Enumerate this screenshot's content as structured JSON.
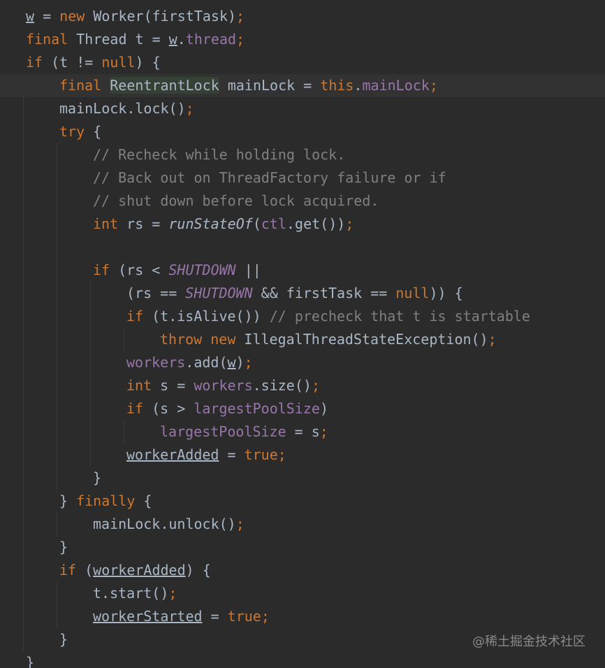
{
  "colors": {
    "background": "#2b2b2b",
    "keyword": "#cc7832",
    "identifier": "#a9b7c6",
    "field": "#9876aa",
    "comment": "#808080",
    "line_highlight": "#323232",
    "type_highlight": "#344134"
  },
  "editor": {
    "lines": [
      {
        "indent": 0,
        "tokens": [
          {
            "text": "w",
            "c": "id",
            "u": true
          },
          {
            "text": " = ",
            "c": "id"
          },
          {
            "text": "new ",
            "c": "kw"
          },
          {
            "text": "Worker(firstTask)",
            "c": "id"
          },
          {
            "text": ";",
            "c": "semi"
          }
        ]
      },
      {
        "indent": 0,
        "tokens": [
          {
            "text": "final ",
            "c": "kw"
          },
          {
            "text": "Thread t = ",
            "c": "id"
          },
          {
            "text": "w",
            "c": "id",
            "u": true
          },
          {
            "text": ".",
            "c": "id"
          },
          {
            "text": "thread",
            "c": "field"
          },
          {
            "text": ";",
            "c": "semi"
          }
        ]
      },
      {
        "indent": 0,
        "tokens": [
          {
            "text": "if ",
            "c": "kw"
          },
          {
            "text": "(t != ",
            "c": "id"
          },
          {
            "text": "null",
            "c": "kw"
          },
          {
            "text": ") {",
            "c": "id"
          }
        ]
      },
      {
        "indent": 1,
        "highlight": true,
        "tokens": [
          {
            "text": "final ",
            "c": "kw"
          },
          {
            "text": "ReentrantLock",
            "c": "typehl"
          },
          {
            "text": " mainLock = ",
            "c": "id"
          },
          {
            "text": "this",
            "c": "kw"
          },
          {
            "text": ".",
            "c": "id"
          },
          {
            "text": "mainLock",
            "c": "field"
          },
          {
            "text": ";",
            "c": "semi"
          }
        ]
      },
      {
        "indent": 1,
        "tokens": [
          {
            "text": "mainLock.lock()",
            "c": "id"
          },
          {
            "text": ";",
            "c": "semi"
          }
        ]
      },
      {
        "indent": 1,
        "tokens": [
          {
            "text": "try ",
            "c": "kw"
          },
          {
            "text": "{",
            "c": "id"
          }
        ]
      },
      {
        "indent": 2,
        "tokens": [
          {
            "text": "// Recheck while holding lock.",
            "c": "comment"
          }
        ]
      },
      {
        "indent": 2,
        "tokens": [
          {
            "text": "// Back out on ThreadFactory failure or if",
            "c": "comment"
          }
        ]
      },
      {
        "indent": 2,
        "tokens": [
          {
            "text": "// shut down before lock acquired.",
            "c": "comment"
          }
        ]
      },
      {
        "indent": 2,
        "tokens": [
          {
            "text": "int ",
            "c": "kw"
          },
          {
            "text": "rs = ",
            "c": "id"
          },
          {
            "text": "runStateOf",
            "c": "static"
          },
          {
            "text": "(",
            "c": "id"
          },
          {
            "text": "ctl",
            "c": "field"
          },
          {
            "text": ".get())",
            "c": "id"
          },
          {
            "text": ";",
            "c": "semi"
          }
        ]
      },
      {
        "indent": 2,
        "tokens": []
      },
      {
        "indent": 2,
        "tokens": [
          {
            "text": "if ",
            "c": "kw"
          },
          {
            "text": "(rs < ",
            "c": "id"
          },
          {
            "text": "SHUTDOWN",
            "c": "const"
          },
          {
            "text": " ||",
            "c": "id"
          }
        ]
      },
      {
        "indent": 3,
        "tokens": [
          {
            "text": "(rs == ",
            "c": "id"
          },
          {
            "text": "SHUTDOWN",
            "c": "const"
          },
          {
            "text": " && firstTask == ",
            "c": "id"
          },
          {
            "text": "null",
            "c": "kw"
          },
          {
            "text": ")) {",
            "c": "id"
          }
        ]
      },
      {
        "indent": 3,
        "tokens": [
          {
            "text": "if ",
            "c": "kw"
          },
          {
            "text": "(t.isAlive()) ",
            "c": "id"
          },
          {
            "text": "// precheck that t is startable",
            "c": "comment"
          }
        ]
      },
      {
        "indent": 4,
        "tokens": [
          {
            "text": "throw new ",
            "c": "kw"
          },
          {
            "text": "IllegalThreadStateException()",
            "c": "id"
          },
          {
            "text": ";",
            "c": "semi"
          }
        ]
      },
      {
        "indent": 3,
        "tokens": [
          {
            "text": "workers",
            "c": "field"
          },
          {
            "text": ".add(",
            "c": "id"
          },
          {
            "text": "w",
            "c": "id",
            "u": true
          },
          {
            "text": ")",
            "c": "id"
          },
          {
            "text": ";",
            "c": "semi"
          }
        ]
      },
      {
        "indent": 3,
        "tokens": [
          {
            "text": "int ",
            "c": "kw"
          },
          {
            "text": "s = ",
            "c": "id"
          },
          {
            "text": "workers",
            "c": "field"
          },
          {
            "text": ".size()",
            "c": "id"
          },
          {
            "text": ";",
            "c": "semi"
          }
        ]
      },
      {
        "indent": 3,
        "tokens": [
          {
            "text": "if ",
            "c": "kw"
          },
          {
            "text": "(s > ",
            "c": "id"
          },
          {
            "text": "largestPoolSize",
            "c": "field"
          },
          {
            "text": ")",
            "c": "id"
          }
        ]
      },
      {
        "indent": 4,
        "tokens": [
          {
            "text": "largestPoolSize",
            "c": "field"
          },
          {
            "text": " = s",
            "c": "id"
          },
          {
            "text": ";",
            "c": "semi"
          }
        ]
      },
      {
        "indent": 3,
        "tokens": [
          {
            "text": "workerAdded",
            "c": "id",
            "u": true
          },
          {
            "text": " = ",
            "c": "id"
          },
          {
            "text": "true",
            "c": "kw"
          },
          {
            "text": ";",
            "c": "semi"
          }
        ]
      },
      {
        "indent": 2,
        "tokens": [
          {
            "text": "}",
            "c": "id"
          }
        ]
      },
      {
        "indent": 1,
        "tokens": [
          {
            "text": "} ",
            "c": "id"
          },
          {
            "text": "finally ",
            "c": "kw"
          },
          {
            "text": "{",
            "c": "id"
          }
        ]
      },
      {
        "indent": 2,
        "tokens": [
          {
            "text": "mainLock.unlock()",
            "c": "id"
          },
          {
            "text": ";",
            "c": "semi"
          }
        ]
      },
      {
        "indent": 1,
        "tokens": [
          {
            "text": "}",
            "c": "id"
          }
        ]
      },
      {
        "indent": 1,
        "tokens": [
          {
            "text": "if ",
            "c": "kw"
          },
          {
            "text": "(",
            "c": "id"
          },
          {
            "text": "workerAdded",
            "c": "id",
            "u": true
          },
          {
            "text": ") {",
            "c": "id"
          }
        ]
      },
      {
        "indent": 2,
        "tokens": [
          {
            "text": "t.start()",
            "c": "id"
          },
          {
            "text": ";",
            "c": "semi"
          }
        ]
      },
      {
        "indent": 2,
        "tokens": [
          {
            "text": "workerStarted",
            "c": "id",
            "u": true
          },
          {
            "text": " = ",
            "c": "id"
          },
          {
            "text": "true",
            "c": "kw"
          },
          {
            "text": ";",
            "c": "semi"
          }
        ]
      },
      {
        "indent": 1,
        "tokens": [
          {
            "text": "}",
            "c": "id"
          }
        ]
      },
      {
        "indent": 0,
        "tokens": [
          {
            "text": "}",
            "c": "id"
          }
        ]
      }
    ]
  },
  "watermark": "@稀土掘金技术社区"
}
